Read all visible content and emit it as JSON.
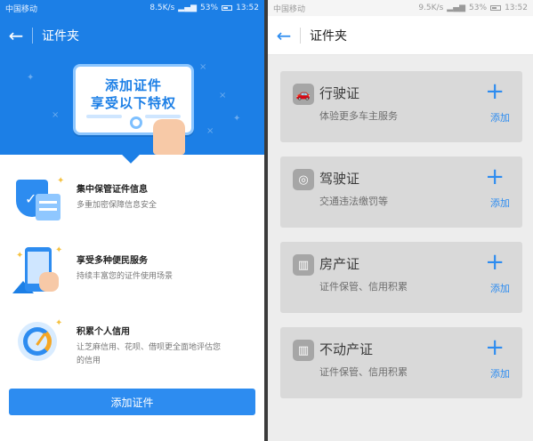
{
  "left": {
    "status_bar": {
      "carrier": "中国移动",
      "net_speed": "8.5K/s",
      "battery": "53%",
      "time": "13:52"
    },
    "header": {
      "back_icon": "←",
      "title": "证件夹"
    },
    "banner": {
      "line1": "添加证件",
      "line2": "享受以下特权"
    },
    "features": [
      {
        "title": "集中保管证件信息",
        "desc": "多重加密保障信息安全",
        "icon": "shield-icon"
      },
      {
        "title": "享受多种便民服务",
        "desc": "持续丰富您的证件使用场景",
        "icon": "phone-icon"
      },
      {
        "title": "积累个人信用",
        "desc": "让芝麻信用、花呗、借呗更全面地评估您的信用",
        "icon": "credit-gauge-icon"
      }
    ],
    "primary_button": "添加证件",
    "colors": {
      "brand_blue": "#1c7fe6",
      "button_blue": "#2d8cf0"
    }
  },
  "right": {
    "status_bar": {
      "carrier": "中国移动",
      "net_speed": "9.5K/s",
      "battery": "53%",
      "time": "13:52"
    },
    "header": {
      "back_icon": "←",
      "title": "证件夹"
    },
    "certificates": [
      {
        "name": "行驶证",
        "desc": "体验更多车主服务",
        "plus": "+",
        "action": "添加",
        "icon": "car-icon",
        "glyph": "🚗"
      },
      {
        "name": "驾驶证",
        "desc": "交通违法缴罚等",
        "plus": "+",
        "action": "添加",
        "icon": "steering-wheel-icon",
        "glyph": "◎"
      },
      {
        "name": "房产证",
        "desc": "证件保管、信用积累",
        "plus": "+",
        "action": "添加",
        "icon": "building-icon",
        "glyph": "▥"
      },
      {
        "name": "不动产证",
        "desc": "证件保管、信用积累",
        "plus": "+",
        "action": "添加",
        "icon": "building-icon",
        "glyph": "▥"
      }
    ]
  }
}
